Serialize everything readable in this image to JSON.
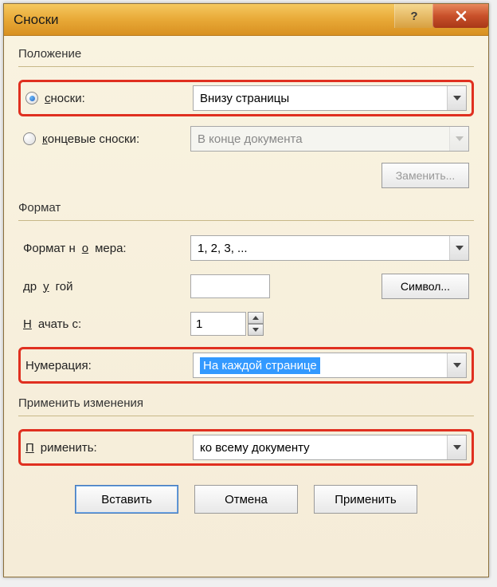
{
  "title": "Сноски",
  "groups": {
    "position": {
      "label": "Положение",
      "footnotes_label": "сноски:",
      "footnotes_value": "Внизу страницы",
      "endnotes_label": "концевые сноски:",
      "endnotes_value": "В конце документа",
      "convert_btn": "Заменить..."
    },
    "format": {
      "label": "Формат",
      "number_format_label": "Формат номера:",
      "number_format_value": "1, 2, 3, ...",
      "custom_label": "другой",
      "custom_value": "",
      "symbol_btn": "Символ...",
      "start_at_label": "Начать с:",
      "start_at_value": "1",
      "numbering_label": "Нумерация:",
      "numbering_value": "На каждой странице"
    },
    "apply": {
      "label": "Применить изменения",
      "apply_to_label": "Применить:",
      "apply_to_value": "ко всему документу"
    }
  },
  "buttons": {
    "insert": "Вставить",
    "cancel": "Отмена",
    "apply": "Применить"
  }
}
